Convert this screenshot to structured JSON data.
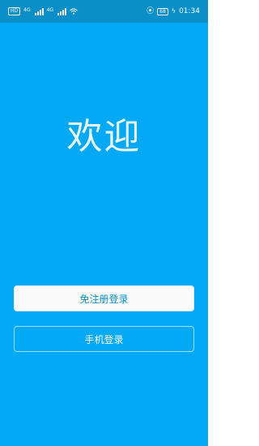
{
  "status_bar": {
    "hd_label": "HD",
    "signal1_gen": "4G",
    "signal2_gen": "4G",
    "battery": "68",
    "time": "01:34"
  },
  "welcome": {
    "title": "欢迎"
  },
  "actions": {
    "guest_login_label": "免注册登录",
    "phone_login_label": "手机登录"
  },
  "colors": {
    "background": "#03A9F4",
    "status_bar": "#0A8FC8",
    "guest_button_bg": "#FAFAFA",
    "guest_button_text": "#0A8FC8"
  },
  "icons": [
    "hd-icon",
    "signal-icon",
    "wifi-icon",
    "vibrate-icon",
    "battery-icon",
    "charging-icon"
  ]
}
